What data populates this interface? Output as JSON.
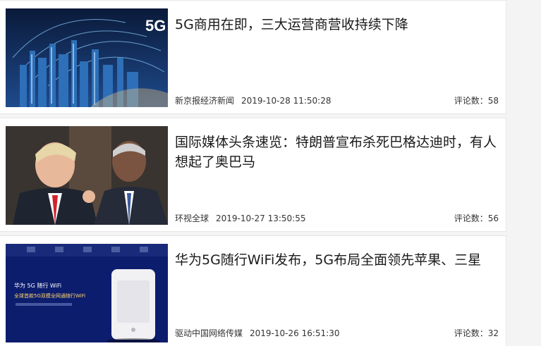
{
  "articles": [
    {
      "title": "5G商用在即，三大运营商营收持续下降",
      "source": "新京报经济新闻",
      "time": "2019-10-28 11:50:28",
      "comments_label": "评论数：",
      "comments_count": "58",
      "image_text": "5G"
    },
    {
      "title": "国际媒体头条速览：特朗普宣布杀死巴格达迪时，有人想起了奥巴马",
      "source": "环视全球",
      "time": "2019-10-27 13:50:55",
      "comments_label": "评论数：",
      "comments_count": "56"
    },
    {
      "title": "华为5G随行WiFi发布，5G布局全面领先苹果、三星",
      "source": "驱动中国网络传媒",
      "time": "2019-10-26 16:51:30",
      "comments_label": "评论数：",
      "comments_count": "32",
      "image_text_1": "华为 5G 随行 WiFi",
      "image_text_2": "全球首款5G双模全网通随行WiFi"
    }
  ],
  "icons": {
    "article_1_image": "5g-city-image",
    "article_2_image": "politicians-photo",
    "article_3_image": "huawei-wifi-device-photo"
  }
}
